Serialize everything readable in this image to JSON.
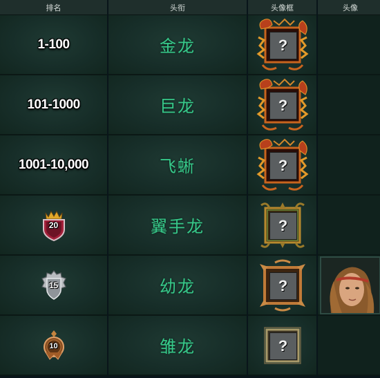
{
  "headers": {
    "rank": "排名",
    "title": "头衔",
    "frame": "头像框",
    "avatar": "头像"
  },
  "rows": [
    {
      "rank": "1-100",
      "title": "金龙",
      "rank_type": "text",
      "frame_style": "dragon-red",
      "avatar": false
    },
    {
      "rank": "101-1000",
      "title": "巨龙",
      "rank_type": "text",
      "frame_style": "dragon-red",
      "avatar": false
    },
    {
      "rank": "1001-10,000",
      "title": "飞蜥",
      "rank_type": "text",
      "frame_style": "dragon-red",
      "avatar": false
    },
    {
      "rank": "20",
      "title": "翼手龙",
      "rank_type": "badge-crown-red",
      "frame_style": "gold-green",
      "avatar": false
    },
    {
      "rank": "15",
      "title": "幼龙",
      "rank_type": "badge-silver",
      "frame_style": "bronze",
      "avatar": true
    },
    {
      "rank": "10",
      "title": "雏龙",
      "rank_type": "badge-bronze",
      "frame_style": "plain-gold",
      "avatar": false
    }
  ],
  "frame_placeholder": "?",
  "colors": {
    "title_green": "#37c98a",
    "background": "#0f2420",
    "header_bg": "#1f2f2c"
  }
}
